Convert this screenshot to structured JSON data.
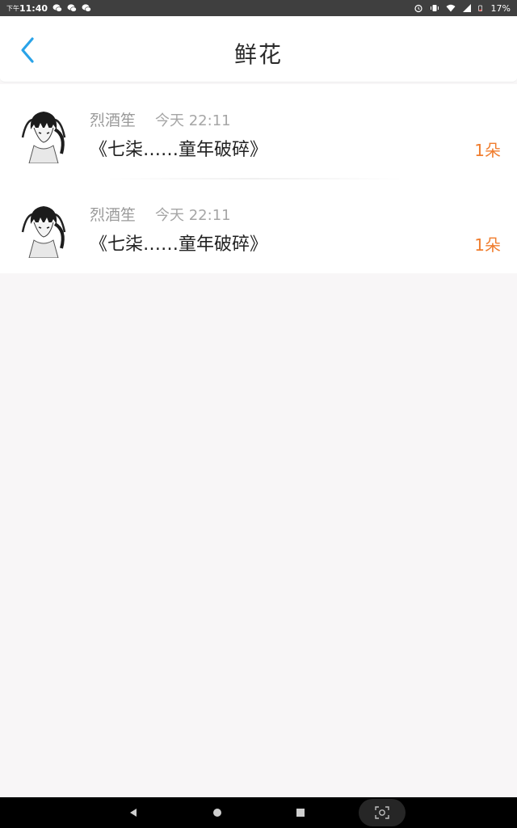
{
  "status_bar": {
    "time_prefix": "下午",
    "time": "11:40",
    "battery": "17%",
    "left_icons": [
      "wechat-icon",
      "wechat-icon",
      "wechat-icon"
    ],
    "right_icons": [
      "alarm-icon",
      "vibrate-icon",
      "wifi-icon",
      "signal-icon",
      "battery-icon"
    ]
  },
  "header": {
    "title": "鲜花",
    "back_icon": "chevron-left-icon"
  },
  "items": [
    {
      "username": "烈酒笙",
      "time": "今天 22:11",
      "work_title": "《七柒……童年破碎》",
      "count": "1朵"
    },
    {
      "username": "烈酒笙",
      "time": "今天 22:11",
      "work_title": "《七柒……童年破碎》",
      "count": "1朵"
    }
  ],
  "nav": {
    "icons": [
      "nav-back-icon",
      "nav-home-icon",
      "nav-recent-icon",
      "screenshot-icon"
    ]
  },
  "colors": {
    "accent_blue": "#2aa3e8",
    "count_orange": "#f07d2e",
    "status_bar": "#3f3f3f",
    "page_bg": "#f8f6f7"
  }
}
